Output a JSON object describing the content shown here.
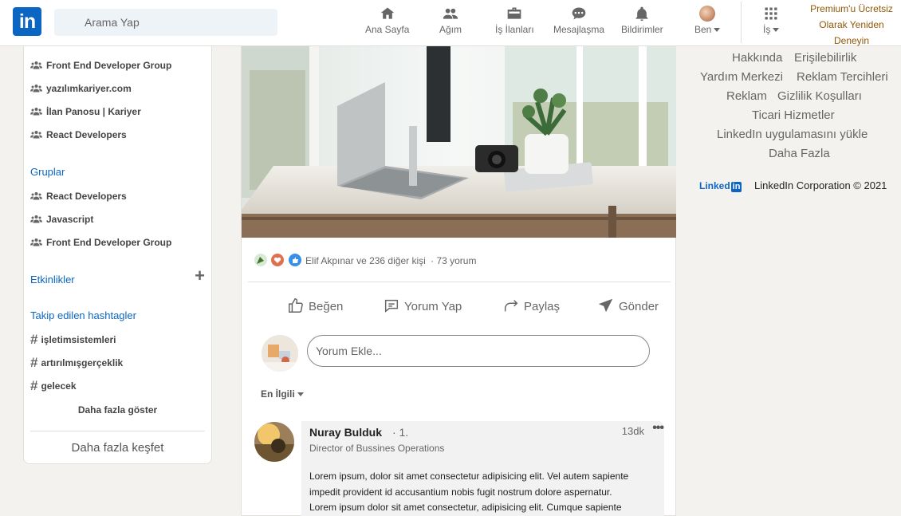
{
  "header": {
    "logo_text": "in",
    "search_placeholder": "Arama Yap",
    "nav": {
      "home": "Ana Sayfa",
      "network": "Ağım",
      "jobs": "İş İlanları",
      "messaging": "Mesajlaşma",
      "notifications": "Bildirimler",
      "me": "Ben",
      "work": "İş"
    },
    "premium_line1": "Premium'u Ücretsiz",
    "premium_line2": "Olarak Yeniden",
    "premium_line3": "Deneyin"
  },
  "sidebar": {
    "groups_top": [
      "Front End Developer Group",
      "yazılımkariyer.com",
      "İlan Panosu | Kariyer",
      "React Developers"
    ],
    "groups_heading": "Gruplar",
    "groups": [
      "React Developers",
      "Javascript",
      "Front End Developer Group"
    ],
    "events_heading": "Etkinlikler",
    "hashtags_heading": "Takip edilen hashtagler",
    "hashtags": [
      "işletimsistemleri",
      "artırılmışgerçeklik",
      "gelecek"
    ],
    "show_more": "Daha fazla göster",
    "discover_more": "Daha fazla keşfet"
  },
  "post": {
    "reactions_text": "Elif Akpınar ve 236 diğer kişi",
    "comments_count": "· 73 yorum",
    "actions": {
      "like": "Beğen",
      "comment": "Yorum Yap",
      "share": "Paylaş",
      "send": "Gönder"
    },
    "comment_placeholder": "Yorum Ekle...",
    "sort_label": "En İlgili",
    "comment": {
      "author": "Nuray Bulduk",
      "degree": "· 1.",
      "time": "13dk",
      "title": "Director of Bussines Operations",
      "text_l1": "Lorem ipsum, dolor sit amet consectetur adipisicing elit. Vel autem sapiente",
      "text_l2": "impedit provident id accusantium nobis fugit nostrum dolore aspernatur.",
      "text_l3": "Lorem ipsum dolor sit amet consectetur, adipisicing elit. Cumque sapiente"
    }
  },
  "footer": {
    "links": [
      "Hakkında",
      "Erişilebilirlik",
      "Yardım Merkezi",
      "Reklam Tercihleri",
      "Reklam",
      "Gizlilik Koşulları",
      "Ticari Hizmetler",
      "LinkedIn uygulamasını yükle",
      "Daha Fazla"
    ],
    "brand_word": "Linked",
    "brand_in": "in",
    "copyright": "LinkedIn Corporation © 2021"
  },
  "colors": {
    "brand": "#0a66c2",
    "premium": "#915907",
    "background": "#f3f2ef"
  }
}
